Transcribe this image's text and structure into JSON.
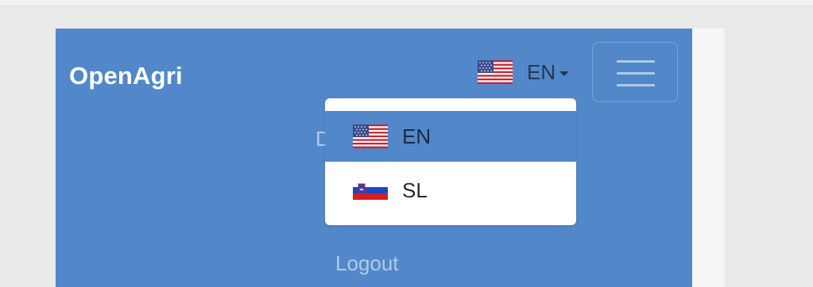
{
  "navbar": {
    "brand": "OpenAgri",
    "background_color": "#5288c9",
    "language_toggle": {
      "label": "EN",
      "flag_icon": "us-flag-icon",
      "caret_icon": "caret-down-icon"
    },
    "menu_button_icon": "hamburger-menu-icon",
    "partial_item_label": "D",
    "logout_label": "Logout"
  },
  "language_dropdown": {
    "items": [
      {
        "label": "EN",
        "flag_icon": "us-flag-icon",
        "active": true
      },
      {
        "label": "SL",
        "flag_icon": "slovenia-flag-icon",
        "active": false
      }
    ]
  }
}
